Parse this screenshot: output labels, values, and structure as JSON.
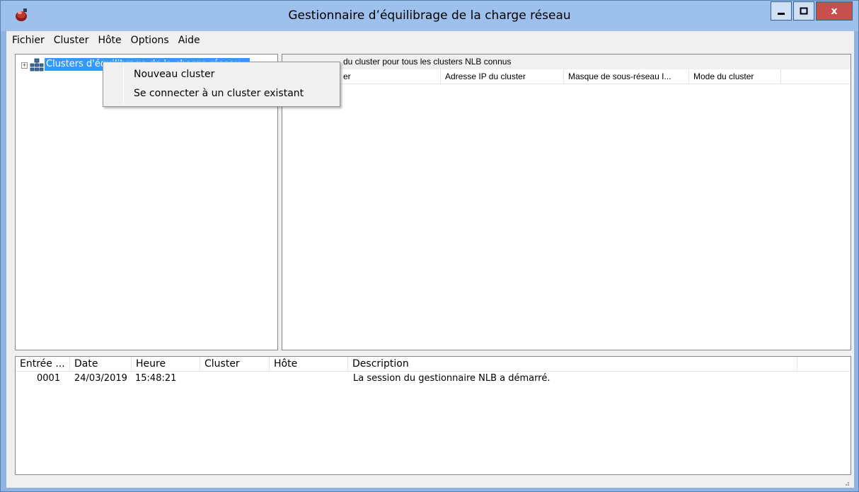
{
  "window": {
    "title": "Gestionnaire d’équilibrage de la charge réseau",
    "minimize_label": "−",
    "maximize_label": "□",
    "close_label": "x"
  },
  "menubar": {
    "items": [
      {
        "label": "Fichier"
      },
      {
        "label": "Cluster"
      },
      {
        "label": "Hôte"
      },
      {
        "label": "Options"
      },
      {
        "label": "Aide"
      }
    ]
  },
  "tree": {
    "root_label": "Clusters d'équilibrage de la charge réseau",
    "expander": "+"
  },
  "context_menu": {
    "items": [
      {
        "label": "Nouveau cluster"
      },
      {
        "label": "Se connecter à un cluster existant"
      }
    ]
  },
  "right_pane": {
    "caption": "du cluster pour tous les clusters NLB connus",
    "columns": [
      {
        "label": "er"
      },
      {
        "label": "Adresse IP du cluster"
      },
      {
        "label": "Masque de sous-réseau I..."
      },
      {
        "label": "Mode du cluster"
      }
    ]
  },
  "log": {
    "columns": [
      {
        "label": "Entrée ..."
      },
      {
        "label": "Date"
      },
      {
        "label": "Heure"
      },
      {
        "label": "Cluster"
      },
      {
        "label": "Hôte"
      },
      {
        "label": "Description"
      }
    ],
    "rows": [
      {
        "entry": "0001",
        "date": "24/03/2019",
        "time": "15:48:21",
        "cluster": "",
        "host": "",
        "description": "La session du gestionnaire NLB a démarré."
      }
    ]
  },
  "colors": {
    "titlebar": "#9ec0ec",
    "selection": "#3399ff",
    "close_button": "#c7504c"
  }
}
